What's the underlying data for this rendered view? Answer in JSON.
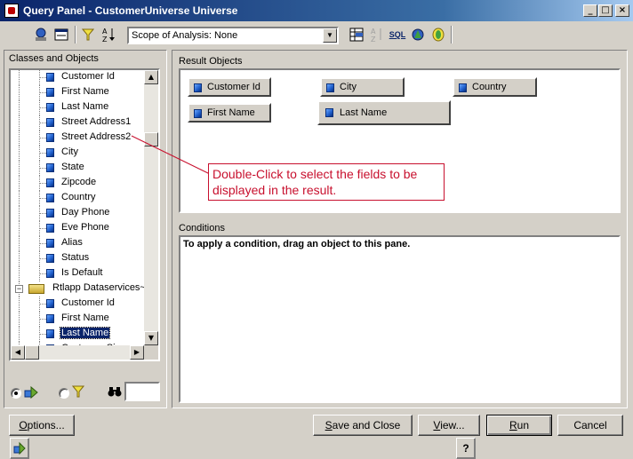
{
  "window": {
    "title": "Query Panel - CustomerUniverse Universe",
    "controls": {
      "minimize": "_",
      "maximize": "□",
      "close": "×"
    }
  },
  "toolbar": {
    "icons": [
      "classes-objects-icon",
      "predefined-conditions-icon",
      "show-sql-window-icon",
      "filter-icon",
      "sort-icon",
      "combine-queries-icon",
      "sql-icon",
      "operand-icon",
      "scope-options-icon",
      "help-icon"
    ],
    "scope": {
      "value": "Scope of Analysis: None",
      "arrow": "▼"
    },
    "labels": {
      "sql": "SQL",
      "help": "?"
    }
  },
  "left_panel": {
    "label": "Classes and Objects",
    "tree": [
      {
        "type": "object",
        "label": "Customer Id"
      },
      {
        "type": "object",
        "label": "First Name"
      },
      {
        "type": "object",
        "label": "Last Name"
      },
      {
        "type": "object",
        "label": "Street Address1"
      },
      {
        "type": "object",
        "label": "Street Address2"
      },
      {
        "type": "object",
        "label": "City"
      },
      {
        "type": "object",
        "label": "State"
      },
      {
        "type": "object",
        "label": "Zipcode"
      },
      {
        "type": "object",
        "label": "Country"
      },
      {
        "type": "object",
        "label": "Day Phone"
      },
      {
        "type": "object",
        "label": "Eve Phone"
      },
      {
        "type": "object",
        "label": "Alias"
      },
      {
        "type": "object",
        "label": "Status"
      },
      {
        "type": "object",
        "label": "Is Default"
      },
      {
        "type": "class",
        "label": "Rtlapp Dataservices~c",
        "expander": "−"
      },
      {
        "type": "object",
        "label": "Customer Id"
      },
      {
        "type": "object",
        "label": "First Name"
      },
      {
        "type": "object",
        "label": "Last Name",
        "selected": true
      },
      {
        "type": "object",
        "label": "Customer Since"
      }
    ],
    "scroll": {
      "up": "▲",
      "down": "▼",
      "left": "◀",
      "right": "▶"
    },
    "bottom": {
      "radio_objects_selected": true,
      "radio_conditions_selected": false,
      "search_value": ""
    }
  },
  "result_objects": {
    "label": "Result Objects",
    "items": [
      "Customer Id",
      "City",
      "Country",
      "First Name",
      "Last Name"
    ]
  },
  "conditions": {
    "label": "Conditions",
    "hint": "To apply a condition, drag an object to this pane."
  },
  "callout": {
    "text": "Double-Click to select the fields to be displayed in the result.",
    "color": "#c8102e"
  },
  "buttons": {
    "options": {
      "pre": "",
      "u": "O",
      "post": "ptions..."
    },
    "save_close": {
      "pre": "",
      "u": "S",
      "post": "ave and Close"
    },
    "view": {
      "pre": "",
      "u": "V",
      "post": "iew..."
    },
    "run": {
      "pre": "",
      "u": "R",
      "post": "un"
    },
    "cancel": "Cancel"
  },
  "colors": {
    "dialog_bg": "#d4d0c8",
    "title_start": "#0a246a",
    "title_end": "#a6caf0",
    "selection": "#0a246a"
  }
}
